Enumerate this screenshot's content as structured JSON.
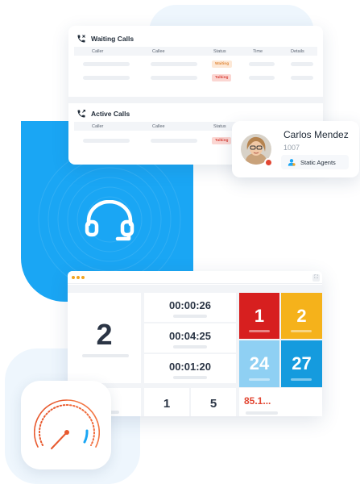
{
  "waiting_calls": {
    "title": "Waiting Calls",
    "columns": [
      "Caller",
      "Callee",
      "Status",
      "Time",
      "Details"
    ],
    "rows": [
      {
        "status": "Waiting"
      },
      {
        "status": "Talking"
      }
    ]
  },
  "active_calls": {
    "title": "Active Calls",
    "columns": [
      "Caller",
      "Callee",
      "Status"
    ],
    "rows": [
      {
        "status": "Talking"
      }
    ]
  },
  "agent": {
    "name": "Carlos Mendez",
    "extension": "1007",
    "group": "Static Agents"
  },
  "wallboard": {
    "big_count": "2",
    "times": [
      "00:00:26",
      "00:04:25",
      "00:01:20"
    ],
    "tiles": [
      {
        "value": "1",
        "color": "#d71f1f"
      },
      {
        "value": "2",
        "color": "#f5b21b"
      },
      {
        "value": "24",
        "color": "#8fd0f3"
      },
      {
        "value": "27",
        "color": "#159bde"
      }
    ],
    "bottom_values": [
      "1",
      "5"
    ],
    "percent_text": "85.1..."
  },
  "colors": {
    "accent_blue": "#1aa6f4",
    "status_red": "#e24632",
    "warning_orange": "#f4a520"
  },
  "icons": [
    "phone-icon",
    "headset-icon",
    "agent-icon",
    "gauge-icon",
    "expand-icon"
  ]
}
